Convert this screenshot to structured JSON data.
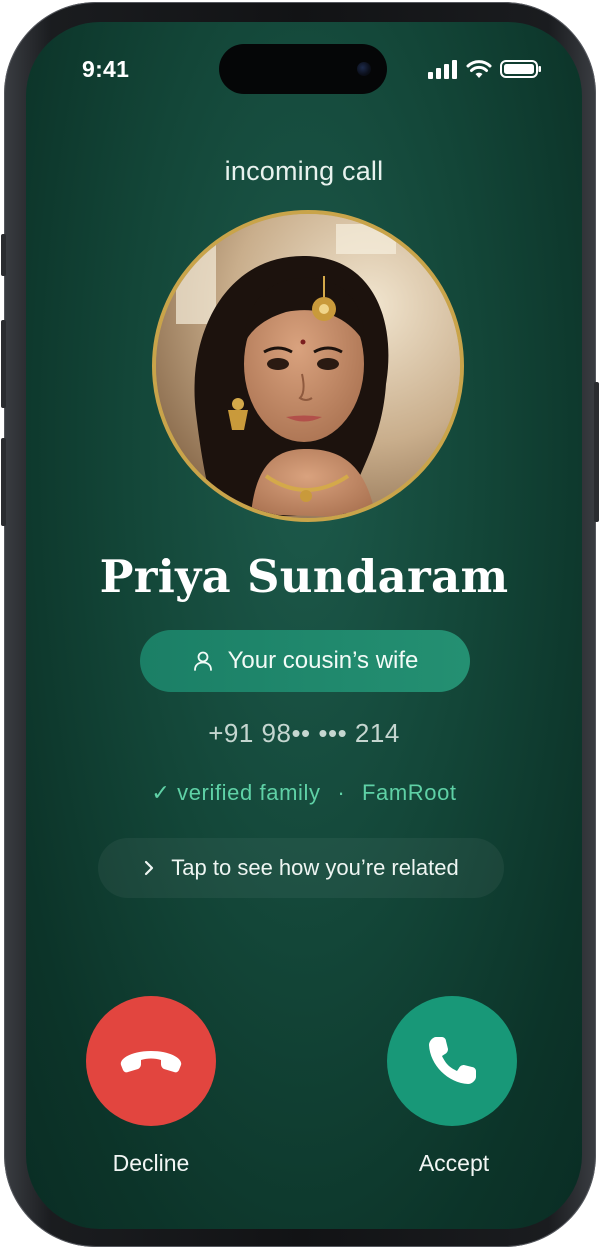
{
  "status_bar": {
    "time": "9:41",
    "icons": [
      "cellular-signal-icon",
      "wifi-icon",
      "battery-icon"
    ]
  },
  "call": {
    "header": "incoming call",
    "caller_name": "Priya Sundaram",
    "relation_label": "Your cousin’s wife",
    "relation_icon": "person-icon",
    "phone_number": "+91 98•• ••• 214",
    "verified_label": "verified family",
    "verified_separator": "·",
    "verified_source": "FamRoot",
    "related_prompt": "Tap to see how you’re related",
    "avatar_alt": "caller photo"
  },
  "actions": {
    "decline_label": "Decline",
    "accept_label": "Accept"
  },
  "colors": {
    "background": "#134638",
    "accent_green": "#249072",
    "verified_green": "#5fd1a6",
    "decline_red": "#e2453f",
    "accept_green": "#189878",
    "avatar_ring": "#c9a44a"
  }
}
